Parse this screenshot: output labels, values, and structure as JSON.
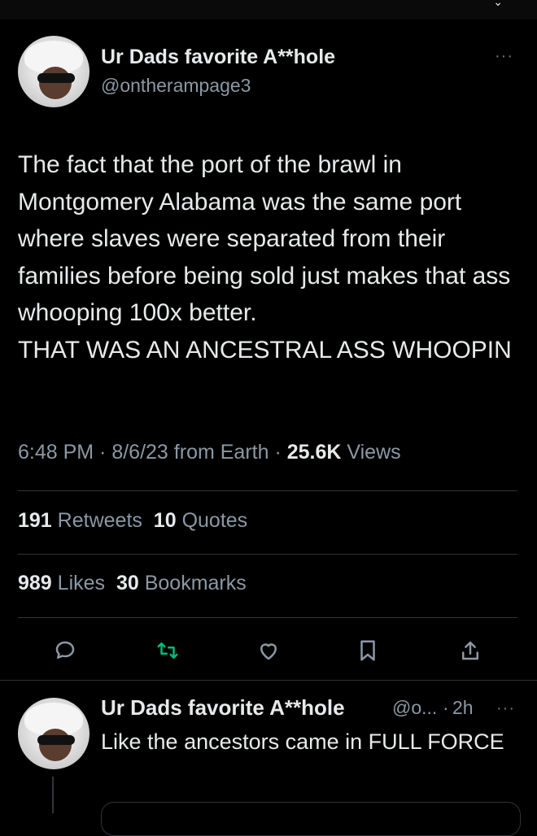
{
  "tweet": {
    "author_name": "Ur Dads favorite A**hole",
    "author_handle": "@ontherampage3",
    "more": "···",
    "text": "The fact that the port of the brawl in Montgomery Alabama was the same port where slaves were separated from their families before being sold just makes that ass whooping 100x better.\nTHAT WAS AN ANCESTRAL ASS WHOOPIN",
    "time": "6:48 PM",
    "date": "8/6/23",
    "source": "from Earth",
    "views_count": "25.6K",
    "views_label": "Views",
    "retweets_count": "191",
    "retweets_label": "Retweets",
    "quotes_count": "10",
    "quotes_label": "Quotes",
    "likes_count": "989",
    "likes_label": "Likes",
    "bookmarks_count": "30",
    "bookmarks_label": "Bookmarks"
  },
  "actions": [
    "reply-icon",
    "retweet-icon",
    "like-icon",
    "bookmark-icon",
    "share-icon"
  ],
  "reply": {
    "author_name": "Ur Dads favorite A**hole",
    "author_handle": "@o...",
    "age": "2h",
    "more": "···",
    "text": "Like the ancestors came in FULL FORCE"
  },
  "colors": {
    "background": "#000000",
    "text": "#e7e9ea",
    "muted": "#8b98a5",
    "retweet_green": "#00ba7c",
    "divider": "#2f3336"
  }
}
